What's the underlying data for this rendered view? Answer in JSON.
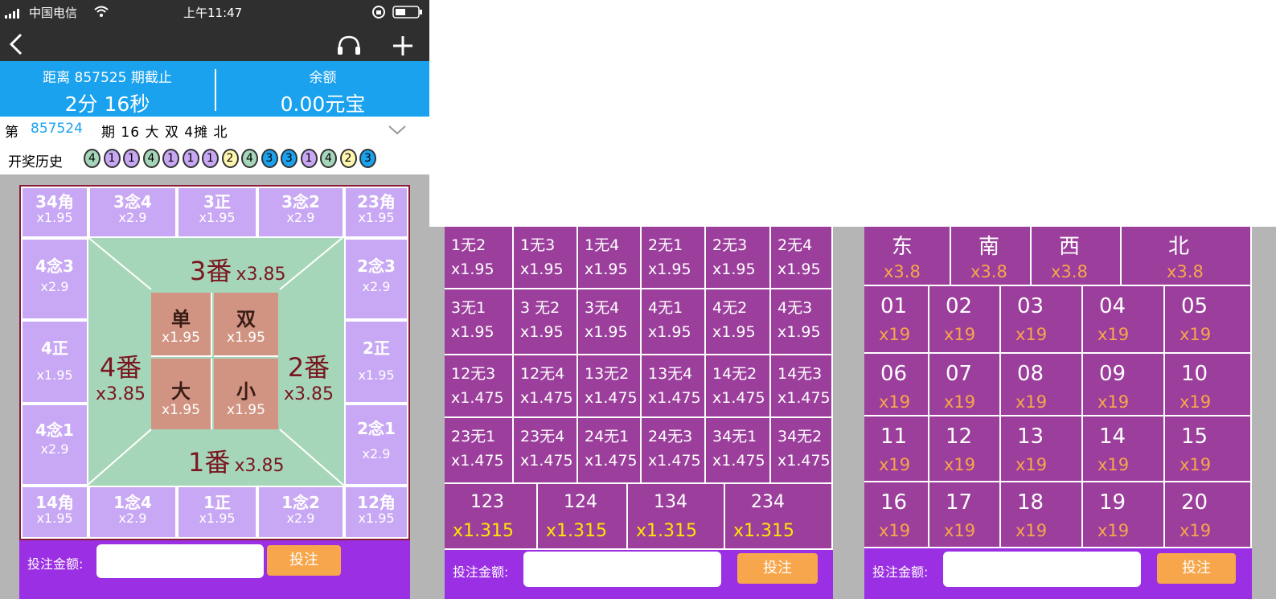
{
  "status": {
    "signal": "中国电信",
    "time": "上午11:47"
  },
  "nav": {
    "back": "back-icon",
    "support": "headset-icon",
    "add": "plus-icon"
  },
  "info": {
    "deadline_label": "距离 857525 期截止",
    "countdown": "2分 16秒",
    "balance_label": "余额",
    "balance": "0.00元宝"
  },
  "period": {
    "prefix": "第",
    "number": "857524",
    "suffix": "期 16 大 双 4摊 北"
  },
  "history": {
    "label": "开奖历史",
    "balls": [
      "4",
      "1",
      "1",
      "4",
      "1",
      "1",
      "1",
      "2",
      "4",
      "3",
      "3",
      "1",
      "4",
      "2",
      "3"
    ]
  },
  "board": {
    "top": [
      {
        "label": "34角",
        "odds": "x1.95"
      },
      {
        "label": "3念4",
        "odds": "x2.9"
      },
      {
        "label": "3正",
        "odds": "x1.95"
      },
      {
        "label": "3念2",
        "odds": "x2.9"
      },
      {
        "label": "23角",
        "odds": "x1.95"
      }
    ],
    "left": [
      {
        "label": "4念3",
        "odds": "x2.9"
      },
      {
        "label": "4正",
        "odds": "x1.95"
      },
      {
        "label": "4念1",
        "odds": "x2.9"
      }
    ],
    "right": [
      {
        "label": "2念3",
        "odds": "x2.9"
      },
      {
        "label": "2正",
        "odds": "x1.95"
      },
      {
        "label": "2念1",
        "odds": "x2.9"
      }
    ],
    "bottom": [
      {
        "label": "14角",
        "odds": "x1.95"
      },
      {
        "label": "1念4",
        "odds": "x2.9"
      },
      {
        "label": "1正",
        "odds": "x1.95"
      },
      {
        "label": "1念2",
        "odds": "x2.9"
      },
      {
        "label": "12角",
        "odds": "x1.95"
      }
    ],
    "fans": {
      "top": {
        "label": "3番",
        "odds": "x3.85"
      },
      "left": {
        "label": "4番",
        "odds": "x3.85"
      },
      "right": {
        "label": "2番",
        "odds": "x3.85"
      },
      "bottom": {
        "label": "1番",
        "odds": "x3.85"
      }
    },
    "center": [
      {
        "label": "单",
        "odds": "x1.95"
      },
      {
        "label": "双",
        "odds": "x1.95"
      },
      {
        "label": "大",
        "odds": "x1.95"
      },
      {
        "label": "小",
        "odds": "x1.95"
      }
    ]
  },
  "bet": {
    "label": "投注金额:",
    "button": "投注"
  },
  "middle": {
    "rows": [
      [
        {
          "label": "1无2",
          "odds": "x1.95"
        },
        {
          "label": "1无3",
          "odds": "x1.95"
        },
        {
          "label": "1无4",
          "odds": "x1.95"
        },
        {
          "label": "2无1",
          "odds": "x1.95"
        },
        {
          "label": "2无3",
          "odds": "x1.95"
        },
        {
          "label": "2无4",
          "odds": "x1.95"
        }
      ],
      [
        {
          "label": "3无1",
          "odds": "x1.95"
        },
        {
          "label": "3 无2",
          "odds": "x1.95"
        },
        {
          "label": "3无4",
          "odds": "x1.95"
        },
        {
          "label": "4无1",
          "odds": "x1.95"
        },
        {
          "label": "4无2",
          "odds": "x1.95"
        },
        {
          "label": "4无3",
          "odds": "x1.95"
        }
      ],
      [
        {
          "label": "12无3",
          "odds": "x1.475"
        },
        {
          "label": "12无4",
          "odds": "x1.475"
        },
        {
          "label": "13无2",
          "odds": "x1.475"
        },
        {
          "label": "13无4",
          "odds": "x1.475"
        },
        {
          "label": "14无2",
          "odds": "x1.475"
        },
        {
          "label": "14无3",
          "odds": "x1.475"
        }
      ],
      [
        {
          "label": "23无1",
          "odds": "x1.475"
        },
        {
          "label": "23无4",
          "odds": "x1.475"
        },
        {
          "label": "24无1",
          "odds": "x1.475"
        },
        {
          "label": "24无3",
          "odds": "x1.475"
        },
        {
          "label": "34无1",
          "odds": "x1.475"
        },
        {
          "label": "34无2",
          "odds": "x1.475"
        }
      ]
    ],
    "triples": [
      {
        "label": "123",
        "odds": "x1.315"
      },
      {
        "label": "124",
        "odds": "x1.315"
      },
      {
        "label": "134",
        "odds": "x1.315"
      },
      {
        "label": "234",
        "odds": "x1.315"
      }
    ]
  },
  "right": {
    "directions": [
      {
        "label": "东",
        "odds": "x3.8"
      },
      {
        "label": "南",
        "odds": "x3.8"
      },
      {
        "label": "西",
        "odds": "x3.8"
      },
      {
        "label": "北",
        "odds": "x3.8"
      }
    ],
    "numbers": [
      {
        "label": "01",
        "odds": "x19"
      },
      {
        "label": "02",
        "odds": "x19"
      },
      {
        "label": "03",
        "odds": "x19"
      },
      {
        "label": "04",
        "odds": "x19"
      },
      {
        "label": "05",
        "odds": "x19"
      },
      {
        "label": "06",
        "odds": "x19"
      },
      {
        "label": "07",
        "odds": "x19"
      },
      {
        "label": "08",
        "odds": "x19"
      },
      {
        "label": "09",
        "odds": "x19"
      },
      {
        "label": "10",
        "odds": "x19"
      },
      {
        "label": "11",
        "odds": "x19"
      },
      {
        "label": "12",
        "odds": "x19"
      },
      {
        "label": "13",
        "odds": "x19"
      },
      {
        "label": "14",
        "odds": "x19"
      },
      {
        "label": "15",
        "odds": "x19"
      },
      {
        "label": "16",
        "odds": "x19"
      },
      {
        "label": "17",
        "odds": "x19"
      },
      {
        "label": "18",
        "odds": "x19"
      },
      {
        "label": "19",
        "odds": "x19"
      },
      {
        "label": "20",
        "odds": "x19"
      }
    ]
  },
  "colors": {
    "blue": "#1aa2ef",
    "purple": "#9c3f9c",
    "lavender": "#c8a8f4",
    "green": "#a6d6b9",
    "brown": "#d29482",
    "orange": "#f7a64b",
    "yellow": "#ffe600"
  }
}
